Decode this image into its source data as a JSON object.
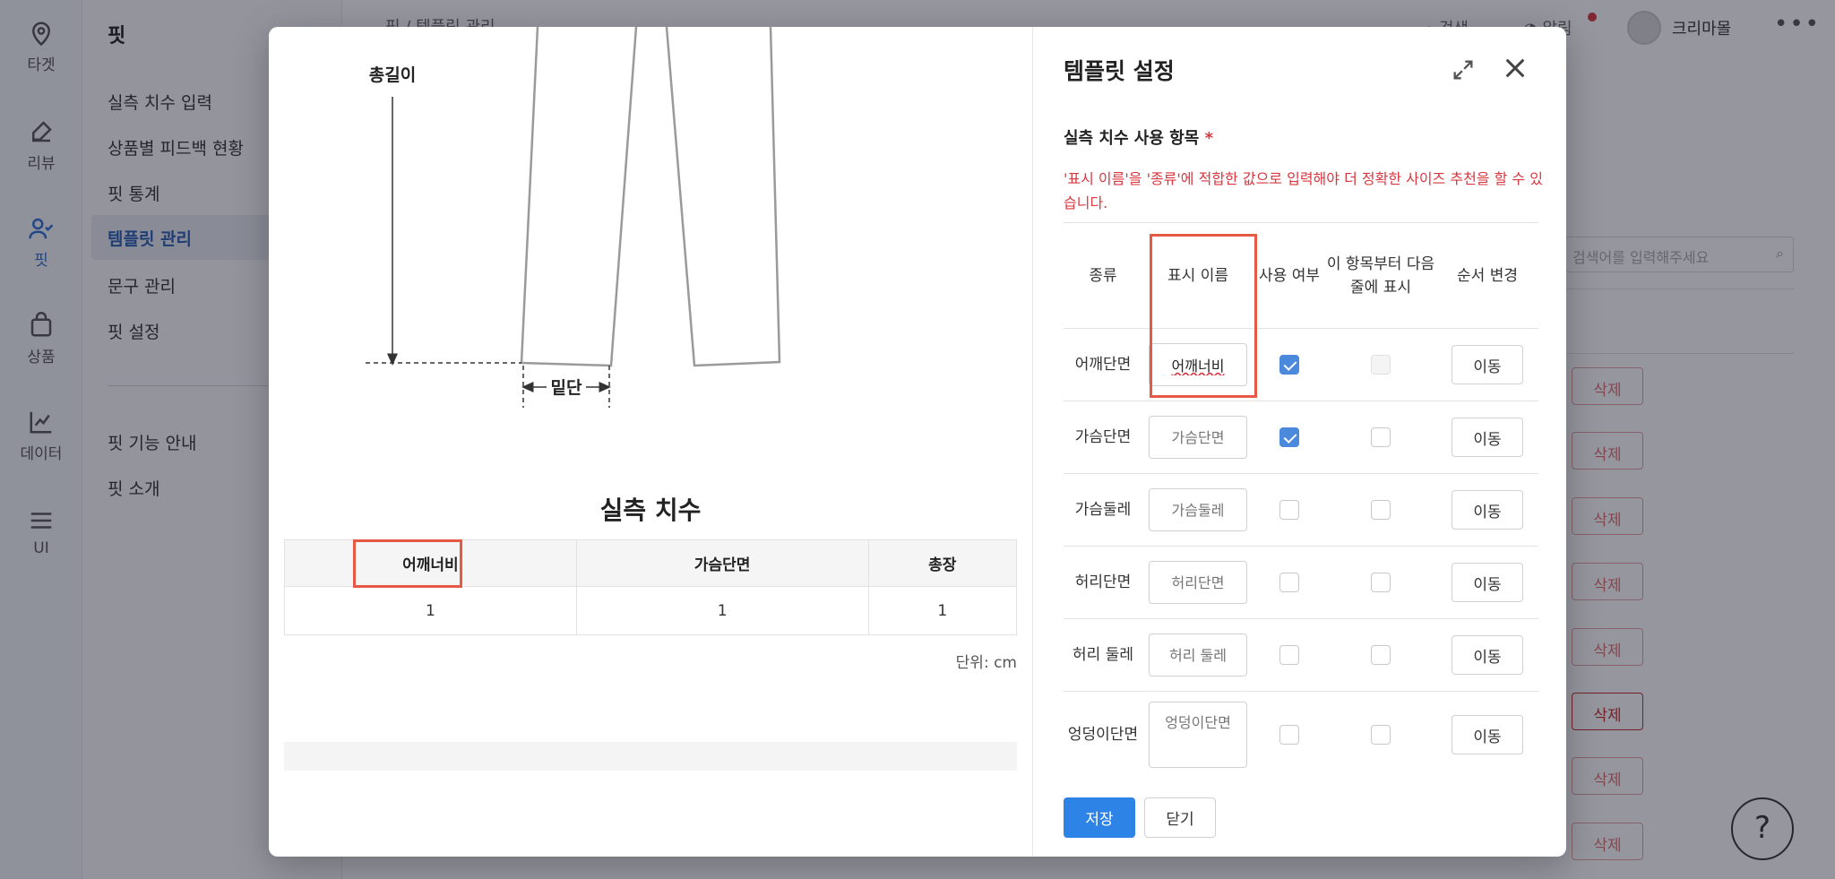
{
  "rail": {
    "items": [
      {
        "label": "타겟",
        "icon": "location-pin-icon"
      },
      {
        "label": "리뷰",
        "icon": "edit-icon"
      },
      {
        "label": "핏",
        "icon": "user-check-icon"
      },
      {
        "label": "상품",
        "icon": "shopping-bag-icon"
      },
      {
        "label": "데이터",
        "icon": "line-chart-icon"
      },
      {
        "label": "UI",
        "icon": "menu-icon"
      }
    ]
  },
  "subnav": {
    "title": "핏",
    "items": [
      "실측 치수 입력",
      "상품별 피드백 현황",
      "핏 통계",
      "템플릿 관리",
      "문구 관리",
      "핏 설정"
    ],
    "items2": [
      "핏 기능 안내",
      "핏 소개"
    ]
  },
  "topbar": {
    "breadcrumb": "핏 / 템플릿 관리",
    "search": "검색",
    "alarm": "알림",
    "user": "크리마몰"
  },
  "background": {
    "search_placeholder": "검색어를 입력해주세요",
    "delete_label": "삭제"
  },
  "preview": {
    "diagram_labels": {
      "total_length": "총길이",
      "hem": "밑단"
    },
    "title": "실측 치수",
    "columns": [
      "어깨너비",
      "가슴단면",
      "총장"
    ],
    "values": [
      "1",
      "1",
      "1"
    ],
    "unit": "단위: cm"
  },
  "panel": {
    "title": "템플릿 설정",
    "section_label": "실측 치수 사용 항목",
    "required_mark": "*",
    "hint": "'표시 이름'을 '종류'에 적합한 값으로 입력해야 더 정확한 사이즈 추천을 할 수 있습니다.",
    "headers": {
      "type": "종류",
      "display_name": "표시 이름",
      "use": "사용 여부",
      "line_break": "이 항목부터 다음 줄에 표시",
      "order": "순서 변경"
    },
    "rows": [
      {
        "type": "어깨단면",
        "value": "어깨너비",
        "placeholder": "",
        "use": true,
        "line_break": false,
        "line_break_disabled": true
      },
      {
        "type": "가슴단면",
        "value": "",
        "placeholder": "가슴단면",
        "use": true,
        "line_break": false,
        "line_break_disabled": false
      },
      {
        "type": "가슴둘레",
        "value": "",
        "placeholder": "가슴둘레",
        "use": false,
        "line_break": false,
        "line_break_disabled": false
      },
      {
        "type": "허리단면",
        "value": "",
        "placeholder": "허리단면",
        "use": false,
        "line_break": false,
        "line_break_disabled": false
      },
      {
        "type": "허리 둘레",
        "value": "",
        "placeholder": "허리 둘레",
        "use": false,
        "line_break": false,
        "line_break_disabled": false
      },
      {
        "type": "엉덩이단면",
        "value": "",
        "placeholder": "엉덩이단면",
        "use": false,
        "line_break": false,
        "line_break_disabled": false
      }
    ],
    "move_label": "이동",
    "save_label": "저장",
    "close_label": "닫기"
  },
  "colors": {
    "primary": "#2e83e6",
    "danger": "#d9363e",
    "highlight": "#e65a45",
    "checkbox": "#4a89dc"
  }
}
